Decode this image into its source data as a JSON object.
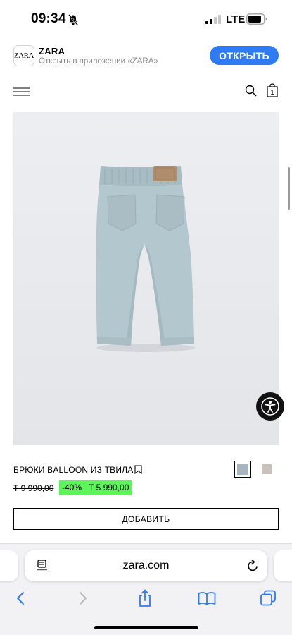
{
  "status_bar": {
    "time": "09:34",
    "network": "LTE",
    "icons": [
      "bell-slash-icon",
      "signal-icon",
      "battery-icon"
    ]
  },
  "app_banner": {
    "logo_text": "ZARA",
    "app_name": "ZARA",
    "subtitle": "Открыть в приложении «ZARA»",
    "open_label": "ОТКРЫТЬ",
    "accent_color": "#2f7bf5"
  },
  "header": {
    "icons": [
      "menu-icon",
      "search-icon",
      "shopping-bag-icon"
    ],
    "bag_count": "1"
  },
  "product": {
    "title": "БРЮКИ BALLOON ИЗ ТВИЛА",
    "old_price": "Т 9 990,00",
    "discount": "-40%",
    "new_price": "Т 5 990,00",
    "price_highlight_color": "#5cf65a",
    "colors": [
      {
        "name": "light-blue",
        "hex": "#a7b5c1",
        "selected": true
      },
      {
        "name": "beige",
        "hex": "#c9c1bb",
        "selected": false
      }
    ],
    "add_label": "ДОБАВИТЬ"
  },
  "browser": {
    "url": "zara.com",
    "toolbar_icons": [
      "back-icon",
      "forward-icon",
      "share-icon",
      "bookmarks-icon",
      "tabs-icon"
    ]
  }
}
